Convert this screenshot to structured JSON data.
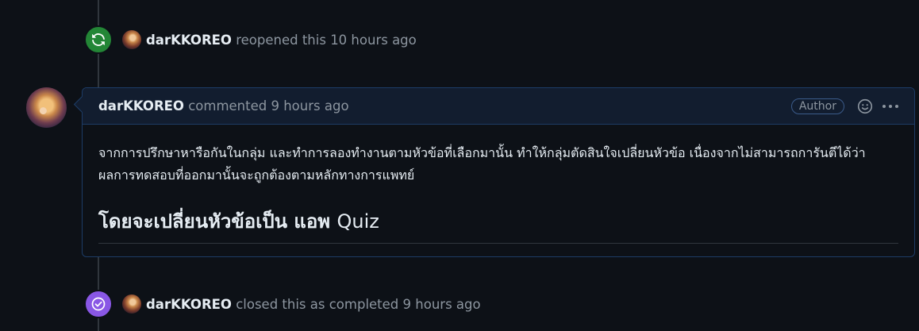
{
  "events": {
    "reopened": {
      "author": "darKKOREO",
      "action": "reopened this",
      "time": "10 hours ago"
    },
    "closed": {
      "author": "darKKOREO",
      "action": "closed this as completed",
      "time": "9 hours ago"
    }
  },
  "comment": {
    "author": "darKKOREO",
    "action": "commented",
    "time": "9 hours ago",
    "badge": "Author",
    "body_line1": "จากการปรึกษาหารือกันในกลุ่ม และทำการลองทำงานตามหัวข้อที่เลือกมานั้น ทำให้กลุ่มตัดสินใจเปลี่ยนหัวข้อ เนื่องจากไม่สามารถการันตีได้ว่า",
    "body_line2": "ผลการทดสอบที่ออกมานั้นจะถูกต้องตามหลักทางการแพทย์",
    "heading_thai": "โดยจะเปลี่ยนหัวข้อเป็น แอพ",
    "heading_latin": "Quiz"
  },
  "icons": {
    "reopened": "sync-icon",
    "closed": "check-circle-icon",
    "reaction": "smiley-icon",
    "menu": "kebab-horizontal-icon"
  },
  "colors": {
    "background": "#0d1117",
    "reopened_badge": "#238636",
    "closed_badge": "#8957e5",
    "comment_header": "#121d2f",
    "comment_border": "#1d3c66",
    "muted_text": "#8d96a0",
    "text": "#e6edf3"
  }
}
